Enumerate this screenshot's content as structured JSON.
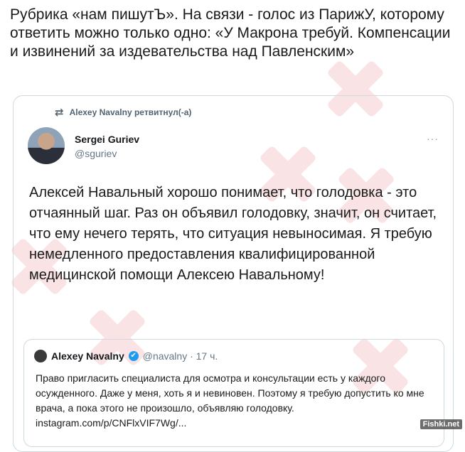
{
  "post": {
    "text": "Рубрика «нам пишутЪ». На связи - голос из ПарижУ, которому ответить можно только одно: «У Макрона требуй. Компенсации и извинений за издевательства над Павленским»"
  },
  "retweet": {
    "header": "Alexey Navalny ретвитнул(-а)",
    "author_name": "Sergei Guriev",
    "author_handle": "@sguriev",
    "text": "Алексей Навальный хорошо понимает, что голодовка - это отчаянный шаг. Раз он объявил голодовку, значит, он считает, что ему нечего терять, что ситуация невыносимая. Я требую немедленного предоставления квалифицированной медицинской помощи Алексею Навальному!",
    "icons": {
      "retweet": "retweet-icon",
      "more": "more-icon"
    }
  },
  "quoted": {
    "name": "Alexey Navalny",
    "verified": "✔",
    "handle_time": "@navalny · 17 ч.",
    "text": "Право пригласить специалиста для осмотра и консультации есть у каждого осужденного. Даже у меня, хоть я и невиновен. Поэтому я требую допустить ко мне врача, а пока этого не произошло, объявляю голодовку.  instagram.com/p/CNFlxVIF7Wg/..."
  },
  "watermark": "Fishki.net",
  "colors": {
    "accent": "#1d9bf0",
    "watermark_cross": "#d0202a",
    "border": "#cfd9de"
  }
}
